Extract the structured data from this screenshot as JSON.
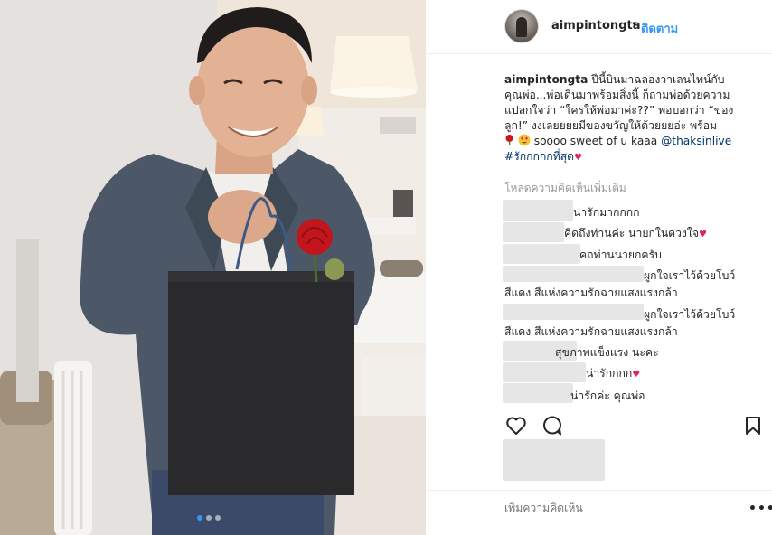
{
  "post": {
    "username": "aimpintongta",
    "separator": "•",
    "follow_label": "ติดตาม",
    "caption": {
      "username": "aimpintongta",
      "line1": "ปีนี้บินมาฉลองวาเลนไทน์กับ",
      "line2": "คุณพ่อ...พ่อเดินมาพร้อมสิ่งนี้ ก็ถามพ่อด้วยความ",
      "line3": "แปลกใจว่า “ใครให้พ่อมาค่ะ??” พ่อบอกว่า “ของ",
      "line4": "ลูก!” งงเลยยยยมีของขวัญให้ด้วยยยอ่ะ พร้อม",
      "line5_text": " soooo sweet of u kaaa ",
      "mention": "@thaksinlive",
      "hashtag": "#รักกกกกที่สุด",
      "heart": "♥"
    },
    "load_more_label": "โหลดความคิดเห็นเพิ่มเติม",
    "comments": [
      {
        "text": "น่ารักมากกกก"
      },
      {
        "text": "คิดถึงท่านค่ะ นายกในดวงใจ",
        "heart": "♥"
      },
      {
        "text": "คถท่านนายกครับ"
      },
      {
        "text": "ผูกใจเราไว้ด้วยโบว์",
        "text2": "สีแดง สีแห่งความรักฉายแสงแรงกล้า"
      },
      {
        "text": "ผูกใจเราไว้ด้วยโบว์",
        "text2": "สีแดง สีแห่งความรักฉายแสงแรงกล้า"
      },
      {
        "text": "สุขภาพแข็งแรง นะคะ"
      },
      {
        "text": "น่ารักกกก",
        "heart": "♥"
      },
      {
        "text": "น่ารักค่ะ คุณพ่อ"
      }
    ],
    "icons": {
      "like": "heart-outline-icon",
      "comment": "speech-bubble-icon",
      "save": "bookmark-icon",
      "more": "ellipsis-icon"
    },
    "add_comment_placeholder": "เพิ่มความคิดเห็น",
    "more_label": "•••",
    "carousel": {
      "count": 3,
      "active": 1
    },
    "colors": {
      "link_blue": "#3897f0",
      "mention_blue": "#003569",
      "heart_red": "#e0245e"
    }
  }
}
